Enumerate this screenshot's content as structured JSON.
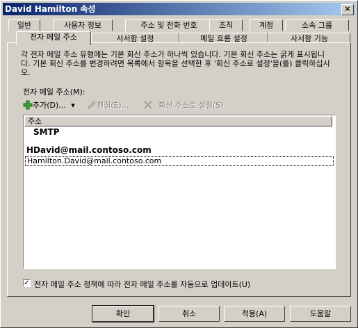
{
  "window": {
    "title": "David Hamilton 속성",
    "close_glyph": "×"
  },
  "tabs_row1": [
    "일반",
    "사용자 정보",
    "주소 및 전화 번호",
    "조직",
    "계정",
    "소속 그룹"
  ],
  "tabs_row2": [
    "전자 메일 주소",
    "사서함 설정",
    "메일 흐름 설정",
    "사서함 기능"
  ],
  "panel": {
    "description": "각 전자 메일 주소 유형에는 기본 회신 주소가 하나씩 있습니다. 기본 회신 주소는 굵게 표시됩니다. 기본 회신 주소를 변경하려면 목록에서 항목을 선택한 후 '회신 주소로 설정'을(를) 클릭하십시오.",
    "email_label": "전자 메일 주소(M):",
    "toolbar": {
      "add_label": "추가(D)...",
      "add_dropdown_glyph": "▾",
      "edit_label": "편집(E)...",
      "remove_label": "",
      "set_reply_label": "회신 주소로 설정(S)"
    },
    "list": {
      "column_header": "주소",
      "group_name": "SMTP",
      "items": [
        {
          "address": "HDavid@mail.contoso.com",
          "primary": true
        },
        {
          "address": "Hamilton.David@mail.contoso.com",
          "primary": false
        }
      ]
    },
    "auto_update_label": "전자 메일 주소 정책에 따라 전자 메일 주소를 자동으로 업데이트(U)",
    "auto_update_checked": true
  },
  "buttons": {
    "ok": "확인",
    "cancel": "취소",
    "apply": "적용(A)",
    "help": "도움말"
  },
  "colors": {
    "face": "#d4d0c8",
    "title_start": "#0a246a",
    "title_end": "#a6caf0",
    "add_icon": "#3aa030",
    "disabled_text": "#808080"
  }
}
